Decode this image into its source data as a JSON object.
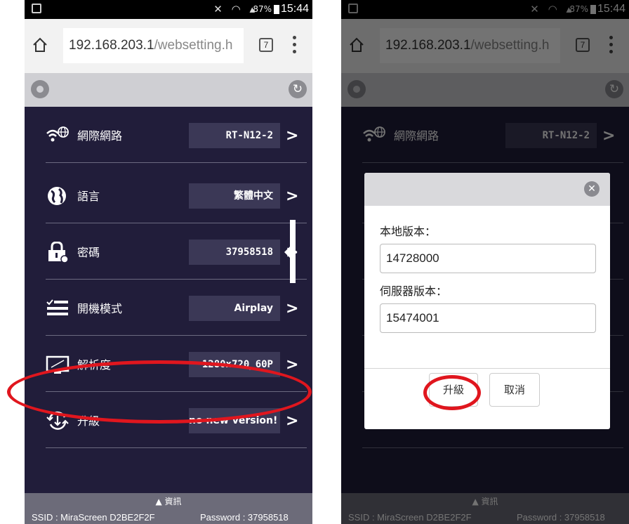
{
  "status_bar": {
    "battery": "87%",
    "time": "15:44"
  },
  "browser": {
    "url_main": "192.168.203.1",
    "url_dim": "/websetting.h",
    "tab_count": "7"
  },
  "menu": [
    {
      "label": "網際網路",
      "value": "RT-N12-2",
      "icon": "wifi-globe-icon"
    },
    {
      "label": "語言",
      "value": "繁體中文",
      "icon": "globe-icon"
    },
    {
      "label": "密碼",
      "value": "37958518",
      "icon": "lock-icon"
    },
    {
      "label": "開機模式",
      "value": "Airplay",
      "icon": "menu-list-icon"
    },
    {
      "label": "解析度",
      "value": "1280x720_60P",
      "icon": "monitor-icon"
    },
    {
      "label": "升級",
      "value": "no new version!",
      "icon": "upgrade-icon"
    }
  ],
  "footer": {
    "info_label": "資訊",
    "ssid": "SSID : MiraScreen D2BE2F2F",
    "password": "Password : 37958518"
  },
  "dialog": {
    "local_version_label": "本地版本：",
    "local_version_value": "14728000",
    "server_version_label": "伺服器版本：",
    "server_version_value": "15474001",
    "upgrade_button": "升級",
    "cancel_button": "取消"
  },
  "colors": {
    "background": "#211d3a",
    "value_box": "#3b3856",
    "highlight": "#e0161e"
  }
}
